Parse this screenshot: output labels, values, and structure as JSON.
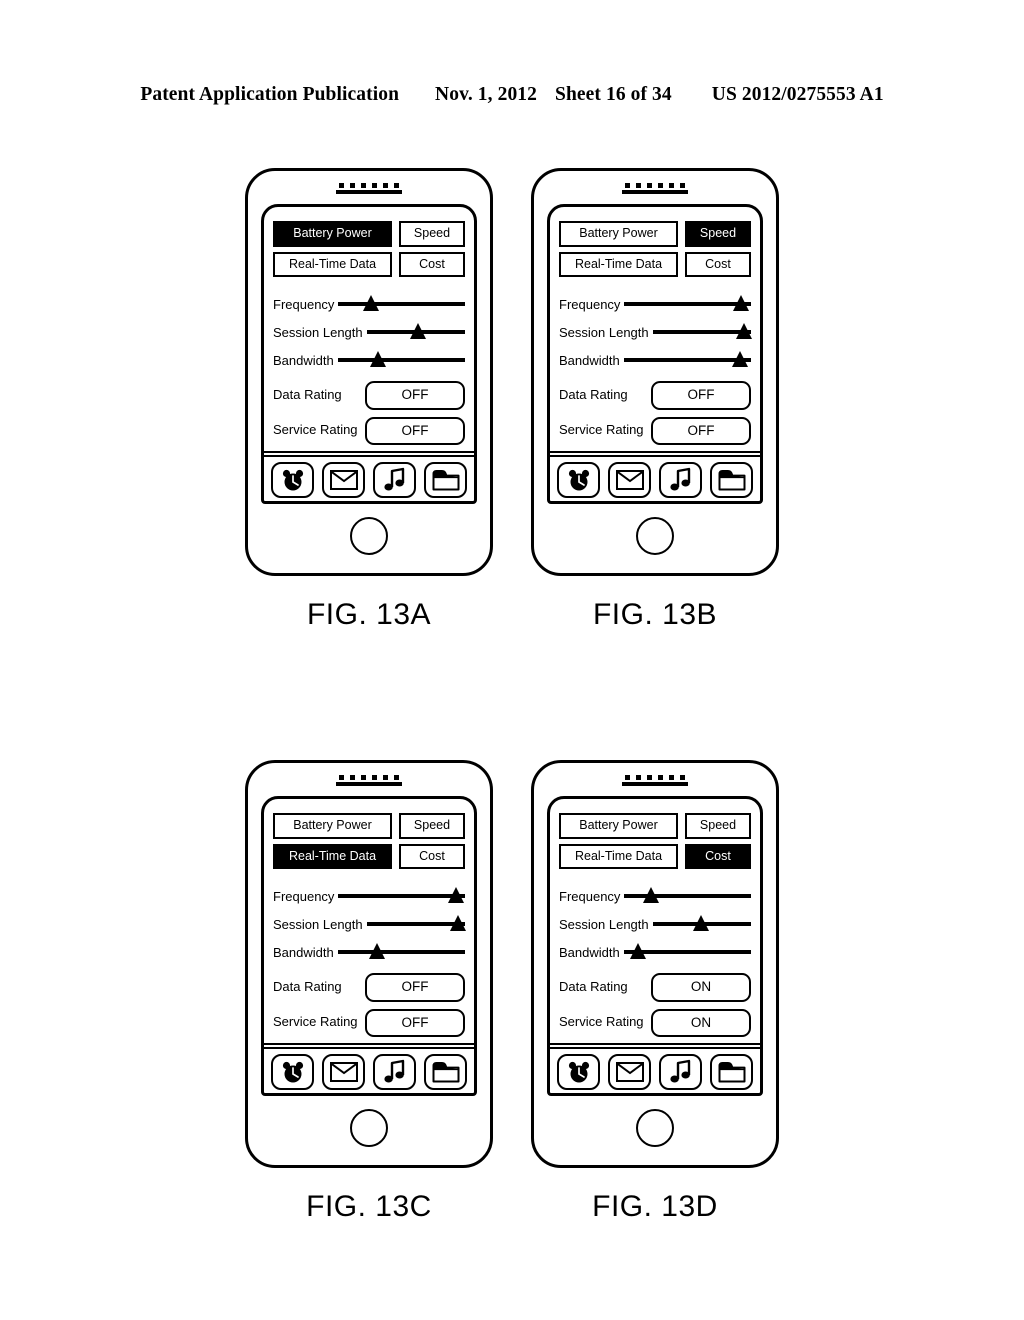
{
  "header": {
    "publication": "Patent Application Publication",
    "date": "Nov. 1, 2012",
    "sheet": "Sheet 16 of 34",
    "number": "US 2012/0275553 A1"
  },
  "ui_labels": {
    "tabs": [
      "Battery Power",
      "Speed",
      "Real-Time Data",
      "Cost"
    ],
    "sliders": [
      "Frequency",
      "Session Length",
      "Bandwidth"
    ],
    "ratings": [
      "Data Rating",
      "Service Rating"
    ],
    "dock_icons": [
      "alarm-clock-icon",
      "envelope-icon",
      "music-note-icon",
      "folder-icon"
    ]
  },
  "figures": [
    {
      "caption": "FIG. 13A",
      "tabs": [
        {
          "label": "Battery Power",
          "selected": true
        },
        {
          "label": "Speed",
          "selected": false
        },
        {
          "label": "Real-Time Data",
          "selected": false
        },
        {
          "label": "Cost",
          "selected": false
        }
      ],
      "sliders": [
        {
          "label": "Frequency",
          "value": 26
        },
        {
          "label": "Session Length",
          "value": 52
        },
        {
          "label": "Bandwidth",
          "value": 32
        }
      ],
      "ratings": [
        {
          "label": "Data Rating",
          "value": "OFF"
        },
        {
          "label": "Service Rating",
          "value": "OFF"
        }
      ]
    },
    {
      "caption": "FIG. 13B",
      "tabs": [
        {
          "label": "Battery Power",
          "selected": false
        },
        {
          "label": "Speed",
          "selected": true
        },
        {
          "label": "Real-Time Data",
          "selected": false
        },
        {
          "label": "Cost",
          "selected": false
        }
      ],
      "sliders": [
        {
          "label": "Frequency",
          "value": 92
        },
        {
          "label": "Session Length",
          "value": 93
        },
        {
          "label": "Bandwidth",
          "value": 91
        }
      ],
      "ratings": [
        {
          "label": "Data Rating",
          "value": "OFF"
        },
        {
          "label": "Service Rating",
          "value": "OFF"
        }
      ]
    },
    {
      "caption": "FIG. 13C",
      "tabs": [
        {
          "label": "Battery Power",
          "selected": false
        },
        {
          "label": "Speed",
          "selected": false
        },
        {
          "label": "Real-Time Data",
          "selected": true
        },
        {
          "label": "Cost",
          "selected": false
        }
      ],
      "sliders": [
        {
          "label": "Frequency",
          "value": 93
        },
        {
          "label": "Session Length",
          "value": 93
        },
        {
          "label": "Bandwidth",
          "value": 31
        }
      ],
      "ratings": [
        {
          "label": "Data Rating",
          "value": "OFF"
        },
        {
          "label": "Service Rating",
          "value": "OFF"
        }
      ]
    },
    {
      "caption": "FIG. 13D",
      "tabs": [
        {
          "label": "Battery Power",
          "selected": false
        },
        {
          "label": "Speed",
          "selected": false
        },
        {
          "label": "Real-Time Data",
          "selected": false
        },
        {
          "label": "Cost",
          "selected": true
        }
      ],
      "sliders": [
        {
          "label": "Frequency",
          "value": 21
        },
        {
          "label": "Session Length",
          "value": 49
        },
        {
          "label": "Bandwidth",
          "value": 11
        }
      ],
      "ratings": [
        {
          "label": "Data Rating",
          "value": "ON"
        },
        {
          "label": "Service Rating",
          "value": "ON"
        }
      ]
    }
  ]
}
